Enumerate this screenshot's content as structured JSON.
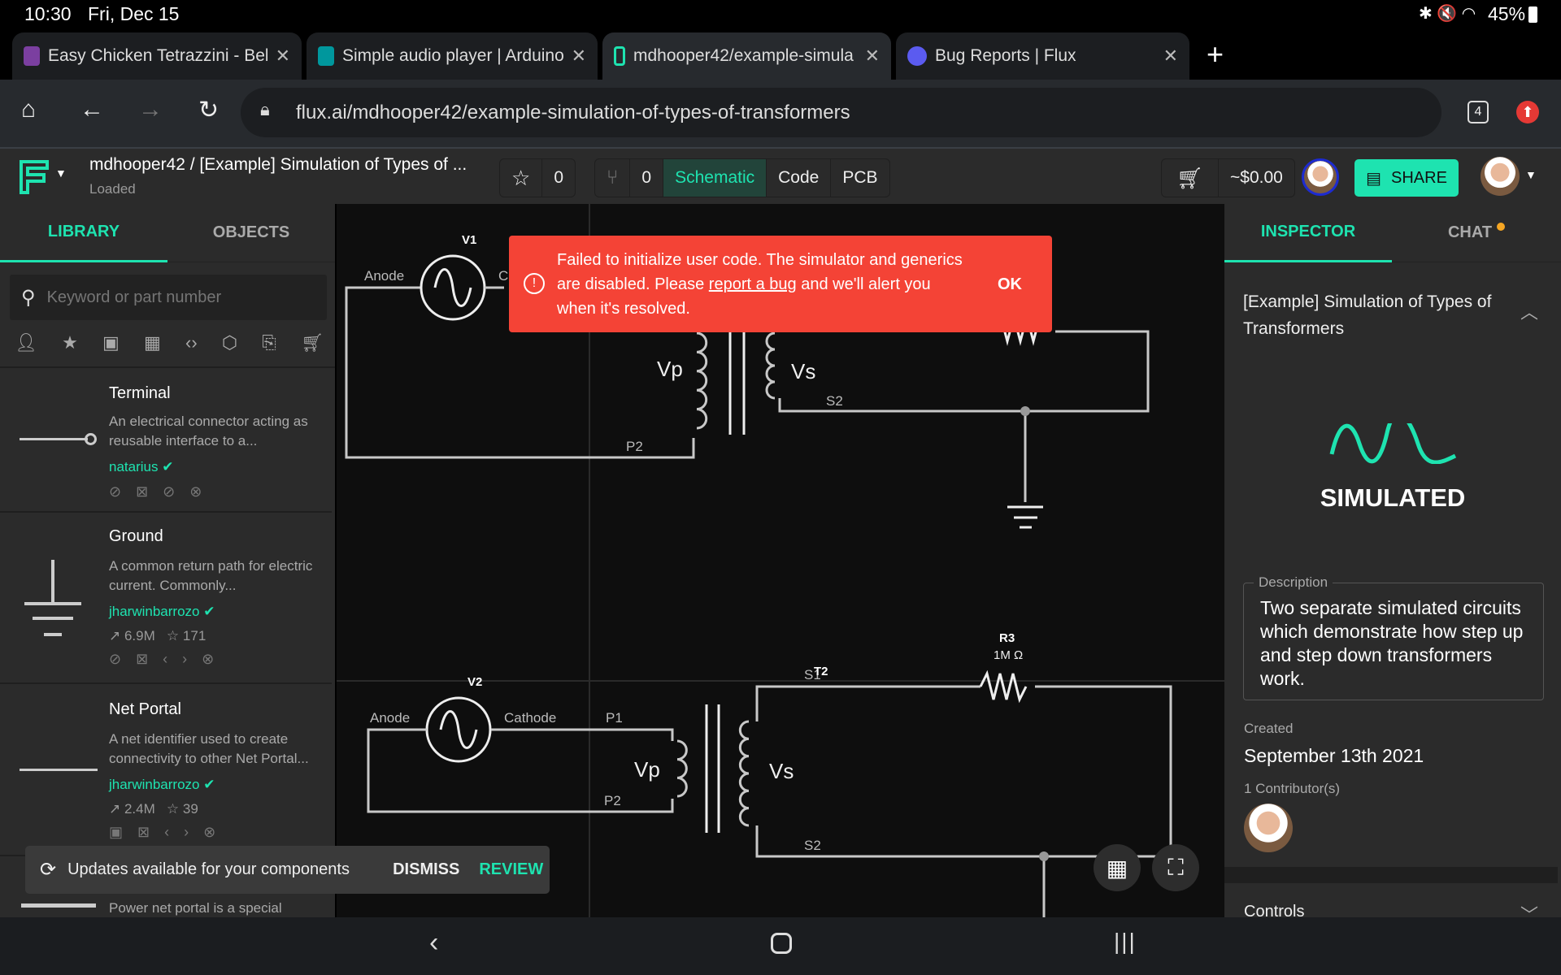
{
  "status": {
    "time": "10:30",
    "date": "Fri, Dec 15",
    "battery": "45%"
  },
  "browser": {
    "tabs": [
      {
        "title": "Easy Chicken Tetrazzini - Bell",
        "color": "#7b3fa0"
      },
      {
        "title": "Simple audio player | Arduino",
        "color": "#00979d"
      },
      {
        "title": "mdhooper42/example-simula",
        "color": "#1ee3b0"
      },
      {
        "title": "Bug Reports | Flux",
        "color": "#5b5bf0"
      }
    ],
    "url": "flux.ai/mdhooper42/example-simulation-of-types-of-transformers",
    "tab_count": "4"
  },
  "header": {
    "project": "mdhooper42 / [Example] Simulation of Types of ...",
    "status": "Loaded",
    "stars": "0",
    "forks": "0",
    "views": [
      "Schematic",
      "Code",
      "PCB"
    ],
    "active_view": "Schematic",
    "cost": "~$0.00",
    "share": "SHARE"
  },
  "library": {
    "tabs": [
      "LIBRARY",
      "OBJECTS"
    ],
    "search_placeholder": "Keyword or part number",
    "items": [
      {
        "name": "Terminal",
        "desc": "An electrical connector acting as reusable interface to a...",
        "author": "natarius"
      },
      {
        "name": "Ground",
        "desc": "A common return path for electric current. Commonly...",
        "author": "jharwinbarrozo",
        "uses": "6.9M",
        "stars": "171"
      },
      {
        "name": "Net Portal",
        "desc": "A net identifier used to create connectivity to other Net Portal...",
        "author": "jharwinbarrozo",
        "uses": "2.4M",
        "stars": "39"
      },
      {
        "desc": "Power net portal is a special"
      }
    ]
  },
  "schematic": {
    "top": {
      "source": "V1",
      "anode": "Anode",
      "cathode": "C",
      "vp": "Vp",
      "vs": "Vs",
      "s2": "S2",
      "p2": "P2"
    },
    "bottom": {
      "source": "V2",
      "anode": "Anode",
      "cathode": "Cathode",
      "p1": "P1",
      "p2": "P2",
      "vp": "Vp",
      "vs": "Vs",
      "s1": "S1",
      "transformer": "T2",
      "s2": "S2",
      "resistor": "R3",
      "resistance": "1M Ω"
    }
  },
  "error": {
    "before": "Failed to initialize user code. The simulator and generics are disabled. Please ",
    "link": "report a bug",
    "after": " and we'll alert you when it's resolved.",
    "ok": "OK"
  },
  "updates": {
    "text": "Updates available for your components",
    "dismiss": "DISMISS",
    "review": "REVIEW"
  },
  "inspector": {
    "tabs": [
      "INSPECTOR",
      "CHAT"
    ],
    "title": "[Example] Simulation of Types of Transformers",
    "badge": "SIMULATED",
    "desc_label": "Description",
    "description": "Two separate simulated circuits which demonstrate how step up and step down transformers work.",
    "created_label": "Created",
    "created": "September 13th 2021",
    "contributors": "1 Contributor(s)",
    "controls": "Controls"
  },
  "colors": {
    "accent": "#1ee3b0",
    "error": "#f44336",
    "chat_dot": "#f5a623"
  }
}
